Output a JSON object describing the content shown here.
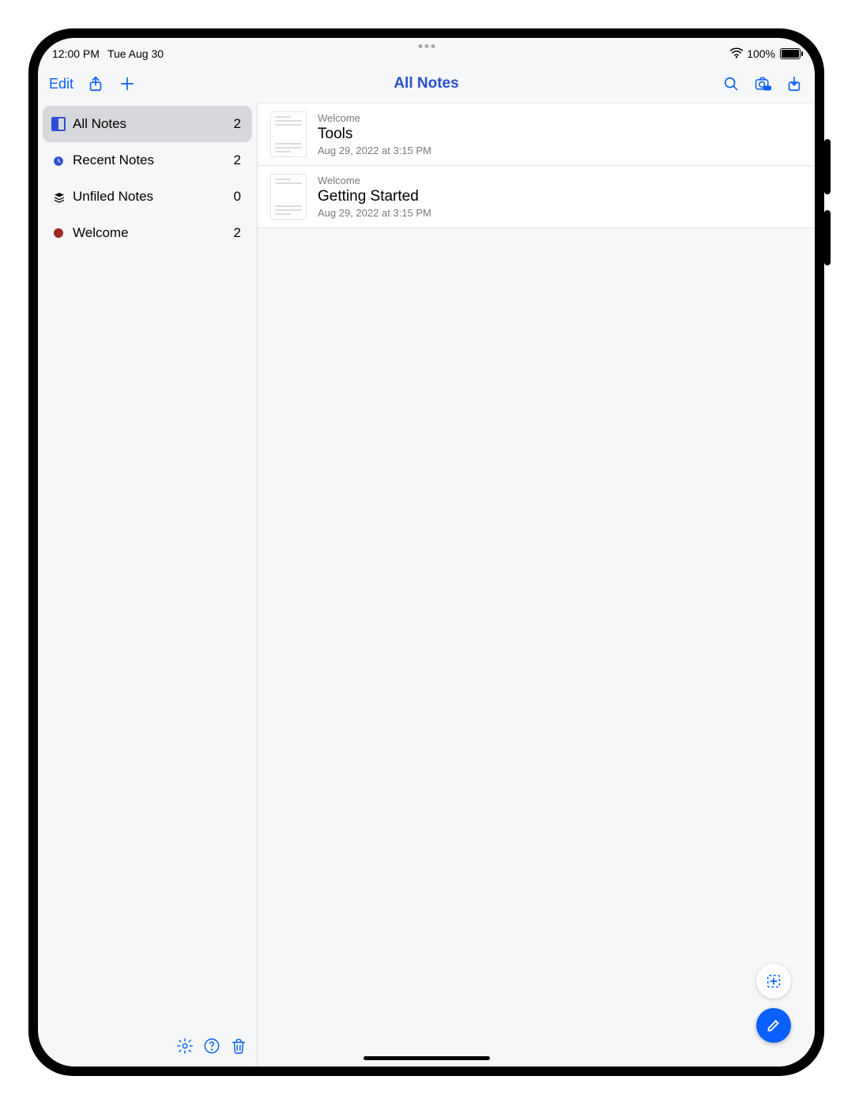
{
  "status": {
    "time": "12:00 PM",
    "date": "Tue Aug 30",
    "battery_pct": "100%"
  },
  "toolbar": {
    "edit_label": "Edit",
    "title": "All Notes"
  },
  "sidebar": {
    "items": [
      {
        "label": "All Notes",
        "count": "2",
        "icon": "all",
        "selected": true
      },
      {
        "label": "Recent Notes",
        "count": "2",
        "icon": "recent",
        "selected": false
      },
      {
        "label": "Unfiled Notes",
        "count": "0",
        "icon": "stack",
        "selected": false
      },
      {
        "label": "Welcome",
        "count": "2",
        "icon": "folder",
        "selected": false
      }
    ]
  },
  "notes": [
    {
      "category": "Welcome",
      "title": "Tools",
      "date": "Aug 29, 2022 at 3:15 PM"
    },
    {
      "category": "Welcome",
      "title": "Getting Started",
      "date": "Aug 29, 2022 at 3:15 PM"
    }
  ]
}
